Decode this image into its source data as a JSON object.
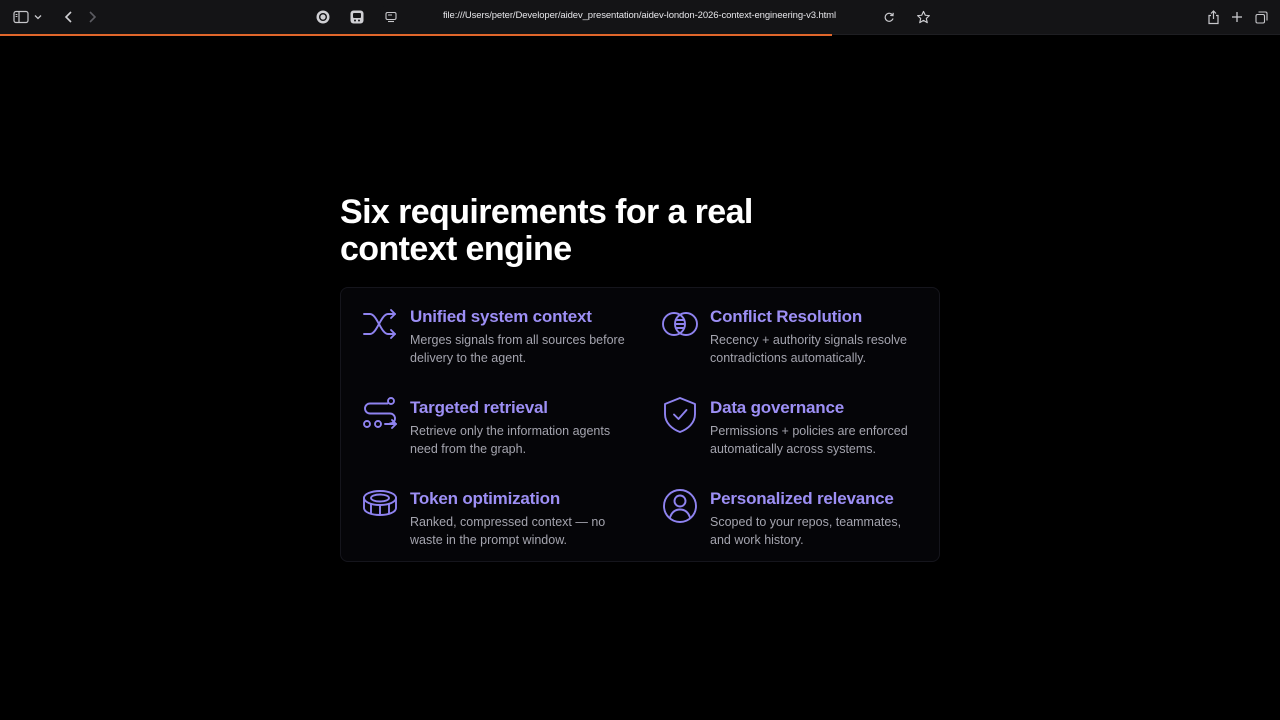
{
  "browser": {
    "url": "file:///Users/peter/Developer/aidev_presentation/aidev-london-2026-context-engineering-v3.html",
    "load_progress": 0.65,
    "accent_color": "#e0662b",
    "icons": [
      "sidebar-icon",
      "chevron-down-icon",
      "back-icon",
      "forward-icon",
      "extension-icon",
      "extension-icon",
      "page-settings-icon",
      "reload-icon",
      "bookmark-star-icon",
      "share-icon",
      "new-tab-icon",
      "tabs-overview-icon"
    ]
  },
  "slide": {
    "title_line1": "Six requirements for a real",
    "title_line2": "context engine",
    "accent_color": "#9d8ff5",
    "features": [
      {
        "icon": "shuffle-icon",
        "heading": "Unified system context",
        "description": "Merges signals from all sources before delivery to the agent."
      },
      {
        "icon": "conflict-resolution-icon",
        "heading": "Conflict Resolution",
        "description": "Recency + authority signals resolve contradictions automatically."
      },
      {
        "icon": "route-icon",
        "heading": "Targeted retrieval",
        "description": "Retrieve only the information agents need from the graph."
      },
      {
        "icon": "shield-check-icon",
        "heading": "Data governance",
        "description": "Permissions + policies are enforced automatically across systems."
      },
      {
        "icon": "coins-stack-icon",
        "heading": "Token optimization",
        "description": "Ranked, compressed context — no waste in the prompt window."
      },
      {
        "icon": "user-circle-icon",
        "heading": "Personalized relevance",
        "description": "Scoped to your repos, teammates, and work history."
      }
    ]
  }
}
